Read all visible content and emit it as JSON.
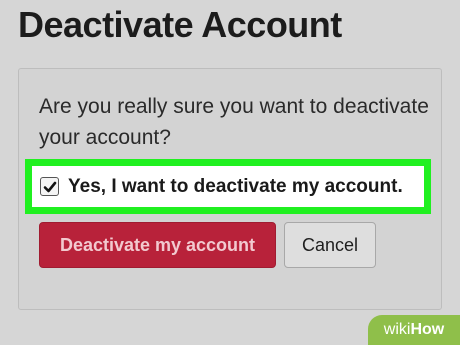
{
  "page": {
    "title": "Deactivate Account"
  },
  "dialog": {
    "question": "Are you really sure you want to deactivate your account?",
    "checkbox": {
      "label": "Yes, I want to deactivate my account.",
      "checked": true
    },
    "buttons": {
      "deactivate": "Deactivate my account",
      "cancel": "Cancel"
    }
  },
  "watermark": {
    "prefix": "wiki",
    "suffix": "How"
  },
  "colors": {
    "highlight": "#20f020",
    "danger": "#b8223a"
  }
}
